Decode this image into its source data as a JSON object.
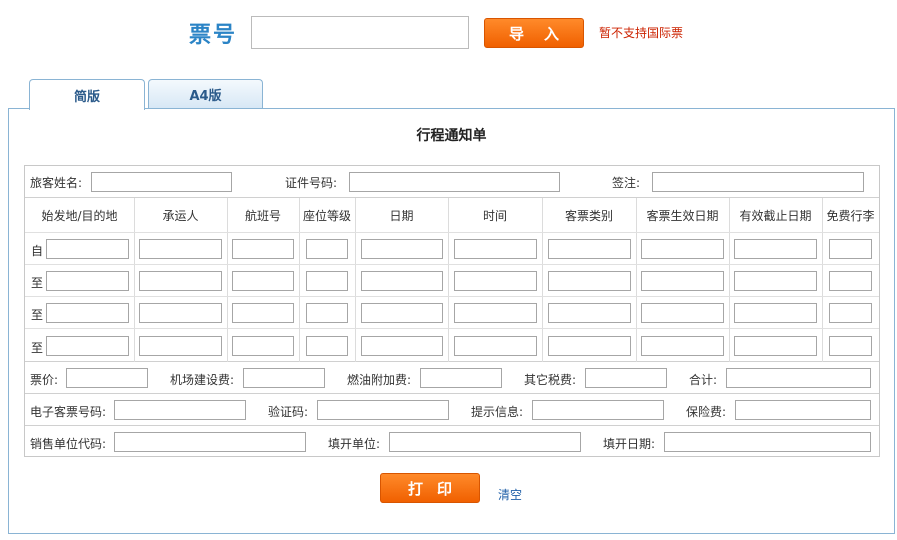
{
  "top": {
    "ticket_label": "票号",
    "ticket_input_value": "",
    "import_button": "导入",
    "intl_note": "暂不支持国际票"
  },
  "tabs": [
    {
      "label": "简版",
      "active": true
    },
    {
      "label": "A4版",
      "active": false
    }
  ],
  "panel": {
    "title": "行程通知单",
    "passenger_label": "旅客姓名:",
    "id_label": "证件号码:",
    "endorse_label": "签注:",
    "flight_headers": [
      "始发地/目的地",
      "承运人",
      "航班号",
      "座位等级",
      "日期",
      "时间",
      "客票类别",
      "客票生效日期",
      "有效截止日期",
      "免费行李"
    ],
    "flight_rows": [
      {
        "prefix": "自"
      },
      {
        "prefix": "至"
      },
      {
        "prefix": "至"
      },
      {
        "prefix": "至"
      }
    ],
    "fare_label": "票价:",
    "airport_fee_label": "机场建设费:",
    "fuel_label": "燃油附加费:",
    "other_tax_label": "其它税费:",
    "total_label": "合计:",
    "eticket_label": "电子客票号码:",
    "verify_label": "验证码:",
    "hint_label": "提示信息:",
    "insurance_label": "保险费:",
    "agent_code_label": "销售单位代码:",
    "issuer_label": "填开单位:",
    "issue_date_label": "填开日期:",
    "print_button": "打印",
    "clear_link": "清空"
  },
  "colors": {
    "accent_blue": "#2b84c6",
    "button_orange": "#f06000",
    "note_red": "#cc2200",
    "border_blue": "#8ab4d4"
  }
}
